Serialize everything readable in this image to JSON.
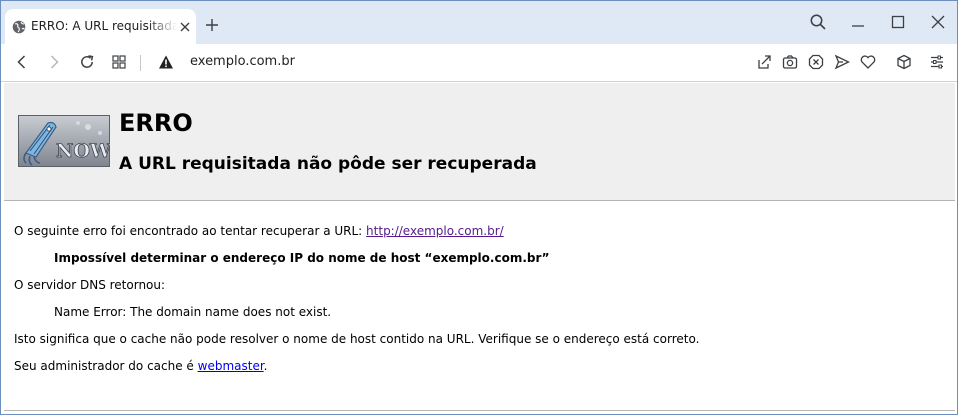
{
  "browser": {
    "tab": {
      "title": "ERRO: A URL requisitada não pôde ser recuperada",
      "favicon": "globe-icon",
      "close_icon": "close-icon"
    },
    "new_tab_icon": "plus-icon",
    "window_controls": [
      "search-tabs-icon",
      "minimize-icon",
      "maximize-icon",
      "close-window-icon"
    ],
    "toolbar": {
      "back_icon": "back-arrow-icon",
      "forward_icon": "forward-arrow-icon",
      "reload_icon": "reload-icon",
      "speed_dial_icon": "grid-icon",
      "security_icon": "warning-icon",
      "url": "exemplo.com.br",
      "right_icons": [
        "share-icon",
        "camera-icon",
        "blocker-icon",
        "send-icon",
        "heart-icon",
        "wallet-icon",
        "menu-icon"
      ]
    }
  },
  "page": {
    "logo_text": "NOW",
    "title": "ERRO",
    "subtitle": "A URL requisitada não pôde ser recuperada",
    "line1_prefix": "O seguinte erro foi encontrado ao tentar recuperar a URL: ",
    "line1_link": "http://exemplo.com.br/",
    "error_message": "Impossível determinar o endereço IP do nome de host “exemplo.com.br”",
    "dns_label": "O servidor DNS retornou:",
    "dns_message": "Name Error: The domain name does not exist.",
    "meaning": "Isto significa que o cache não pode resolver o nome de host contido na URL. Verifique se o endereço está correto.",
    "admin_prefix": "Seu administrador do cache é ",
    "admin_link": "webmaster",
    "admin_suffix": "."
  },
  "colors": {
    "tabstrip_bg": "#dfe9f6",
    "header_bg": "#efefef",
    "visited_link": "#551a8b",
    "link": "#0000ee"
  }
}
